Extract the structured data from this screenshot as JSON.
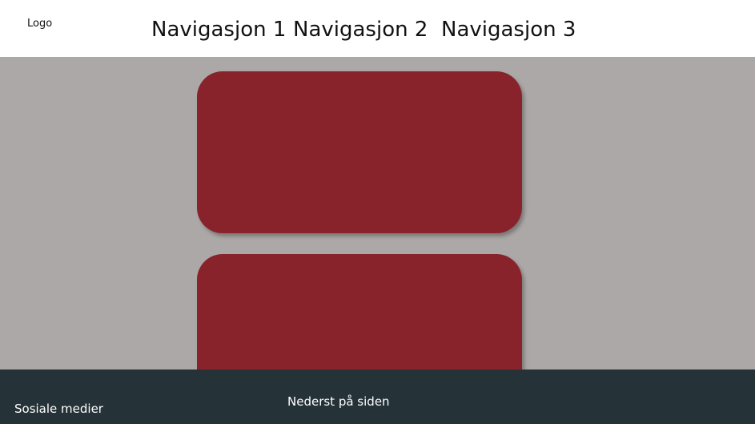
{
  "header": {
    "logo_text": "Logo",
    "nav": [
      {
        "label": "Navigasjon 1"
      },
      {
        "label": "Navigasjon 2"
      },
      {
        "label": "Navigasjon 3"
      }
    ]
  },
  "footer": {
    "social_label": "Sosiale medier",
    "bottom_label": "Nederst på siden"
  },
  "colors": {
    "header_bg": "#ffffff",
    "content_bg": "#aca8a7",
    "card_bg": "#88232c",
    "footer_bg": "#253238",
    "footer_text": "#ffffff"
  }
}
